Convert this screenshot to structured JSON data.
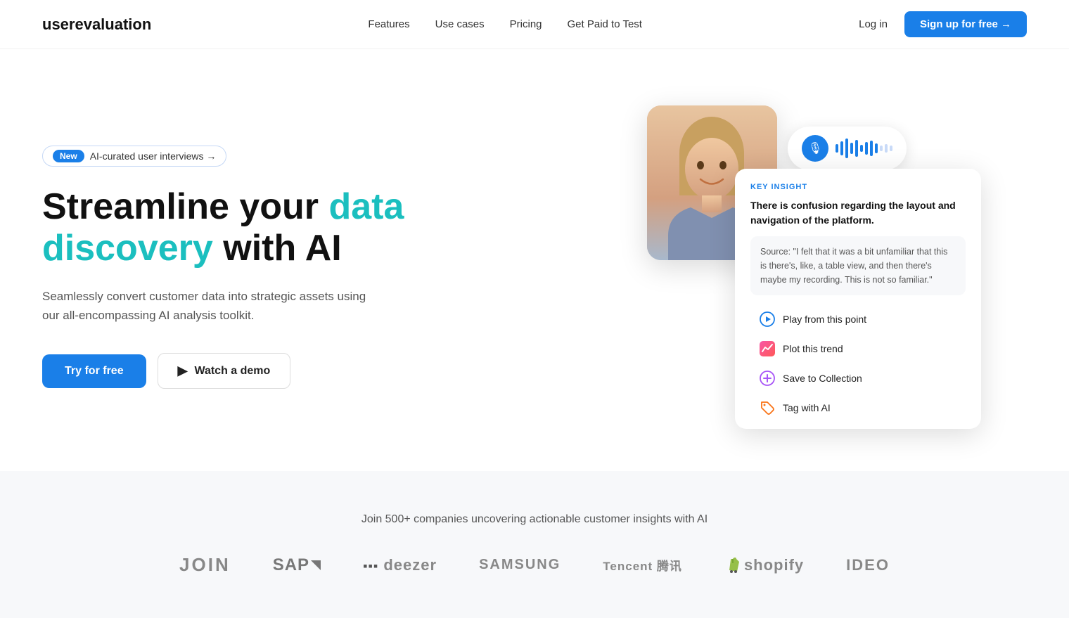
{
  "nav": {
    "logo": "userevaluation",
    "links": [
      {
        "label": "Features",
        "href": "#"
      },
      {
        "label": "Use cases",
        "href": "#"
      },
      {
        "label": "Pricing",
        "href": "#"
      },
      {
        "label": "Get Paid to Test",
        "href": "#"
      }
    ],
    "login_label": "Log in",
    "signup_label": "Sign up for free →"
  },
  "hero": {
    "badge": {
      "new_label": "New",
      "text": "AI-curated user interviews →"
    },
    "title_line1": "Streamline your ",
    "title_highlight1": "data",
    "title_line2": "discovery",
    "title_line2_rest": " with AI",
    "subtitle": "Seamlessly convert customer data into strategic assets using our all-encompassing AI analysis toolkit.",
    "cta_primary": "Try for free",
    "cta_secondary": "Watch a demo"
  },
  "insight_card": {
    "label": "KEY INSIGHT",
    "text": "There is confusion regarding the layout and navigation of the platform.",
    "source": "Source: \"I felt that it was a bit unfamiliar that this is there's, like, a table view, and then there's maybe my recording. This is not so familiar.\""
  },
  "actions": [
    {
      "id": "play",
      "label": "Play from this point",
      "icon_type": "play"
    },
    {
      "id": "trend",
      "label": "Plot this trend",
      "icon_type": "trend"
    },
    {
      "id": "save",
      "label": "Save to Collection",
      "icon_type": "save"
    },
    {
      "id": "tag",
      "label": "Tag with AI",
      "icon_type": "tag"
    }
  ],
  "logos_section": {
    "headline": "Join 500+ companies uncovering actionable customer insights with AI",
    "logos": [
      "JOIN",
      "SAP",
      "deezer",
      "SAMSUNG",
      "Tencent 腾讯",
      "shopify",
      "IDEO"
    ]
  },
  "colors": {
    "primary_blue": "#1a7fe8",
    "teal": "#1bbfbf",
    "purple": "#a855f7",
    "orange": "#f97316"
  }
}
